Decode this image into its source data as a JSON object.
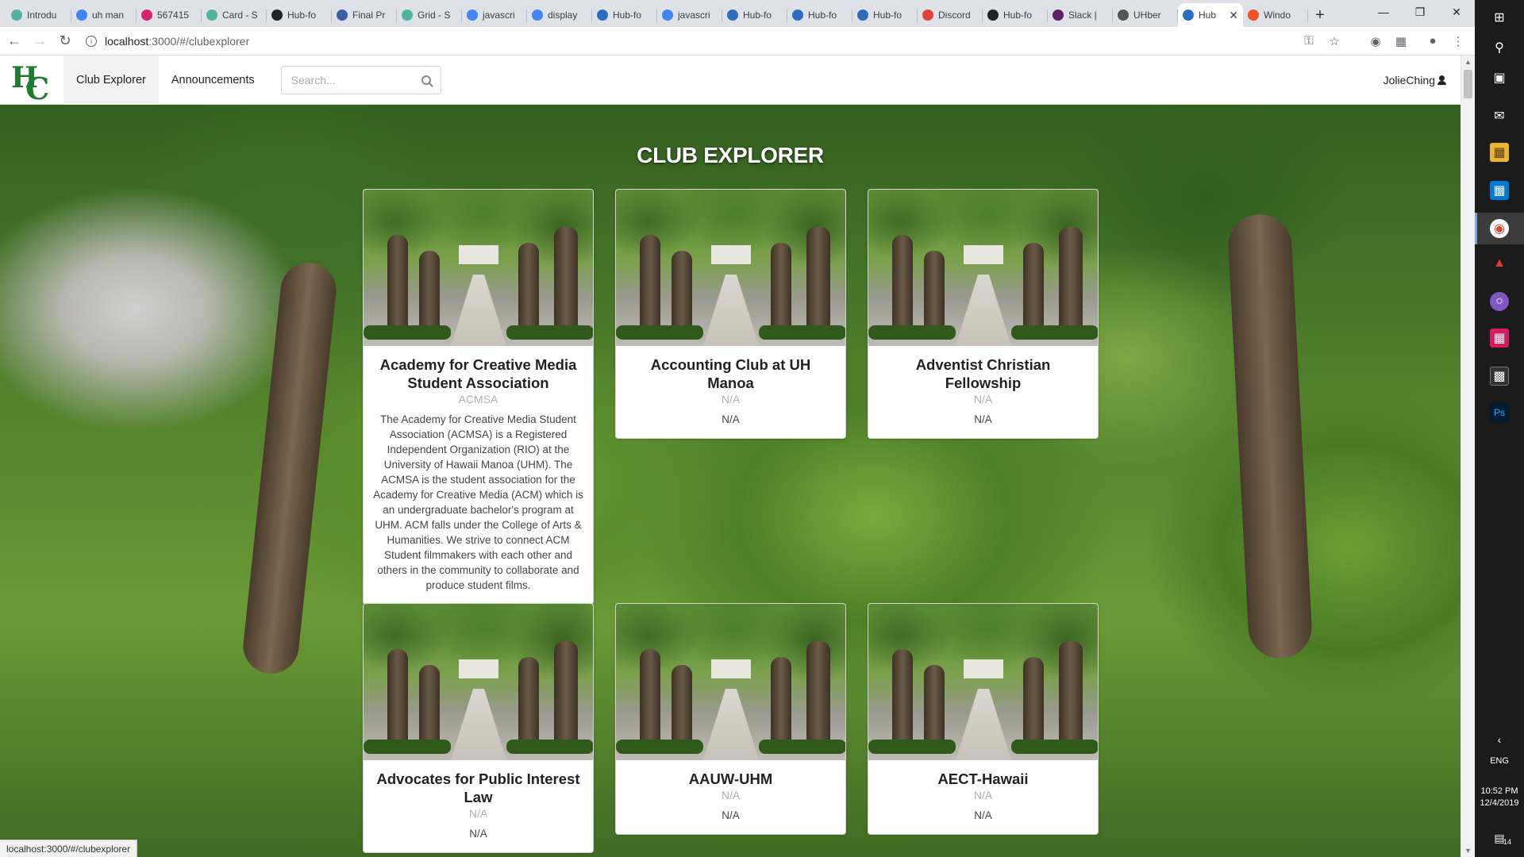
{
  "browser": {
    "tabs": [
      {
        "label": "Introdu",
        "color": "#4fb3a0"
      },
      {
        "label": "uh man",
        "color": "#4285f4"
      },
      {
        "label": "567415",
        "color": "#d6246e"
      },
      {
        "label": "Card - S",
        "color": "#4fb3a0"
      },
      {
        "label": "Hub-fo",
        "color": "#222222"
      },
      {
        "label": "Final Pr",
        "color": "#3b5ea7"
      },
      {
        "label": "Grid - S",
        "color": "#4fb3a0"
      },
      {
        "label": "javascri",
        "color": "#4285f4"
      },
      {
        "label": "display",
        "color": "#4285f4"
      },
      {
        "label": "Hub-fo",
        "color": "#2c6ebd"
      },
      {
        "label": "javascri",
        "color": "#4285f4"
      },
      {
        "label": "Hub-fo",
        "color": "#2c6ebd"
      },
      {
        "label": "Hub-fo",
        "color": "#2c6ebd"
      },
      {
        "label": "Hub-fo",
        "color": "#2c6ebd"
      },
      {
        "label": "Discord",
        "color": "#d9453b"
      },
      {
        "label": "Hub-fo",
        "color": "#222222"
      },
      {
        "label": "Slack |",
        "color": "#611f69"
      },
      {
        "label": "UHber",
        "color": "#555555"
      },
      {
        "label": "Hub",
        "color": "#2c6ebd"
      },
      {
        "label": "Windo",
        "color": "#f25022"
      }
    ],
    "active_tab_index": 18,
    "active_tab_close": "✕",
    "new_tab": "+",
    "window_controls": {
      "minimize": "—",
      "maximize": "❐",
      "close": "✕"
    },
    "url_host": "localhost",
    "url_path": ":3000/#/clubexplorer",
    "status_url": "localhost:3000/#/clubexplorer"
  },
  "navbar": {
    "logo_h": "H",
    "logo_c": "C",
    "items": [
      {
        "label": "Club Explorer",
        "active": true
      },
      {
        "label": "Announcements",
        "active": false
      }
    ],
    "search_placeholder": "Search...",
    "user": "JolieChing"
  },
  "page": {
    "title": "CLUB EXPLORER"
  },
  "cards": [
    {
      "title": "Academy for Creative Media Student Association",
      "meta": "ACMSA",
      "desc": "The Academy for Creative Media Student Association (ACMSA) is a Registered Independent Organization (RIO) at the University of Hawaii Manoa (UHM). The ACMSA is the student association for the Academy for Creative Media (ACM) which is an undergraduate bachelor's program at UHM. ACM falls under the College of Arts & Humanities. We strive to connect ACM Student filmmakers with each other and others in the community to collaborate and produce student films."
    },
    {
      "title": "Accounting Club at UH Manoa",
      "meta": "N/A",
      "desc": "N/A"
    },
    {
      "title": "Adventist Christian Fellowship",
      "meta": "N/A",
      "desc": "N/A"
    },
    {
      "title": "Advocates for Public Interest Law",
      "meta": "N/A",
      "desc": "N/A"
    },
    {
      "title": "AAUW-UHM",
      "meta": "N/A",
      "desc": "N/A"
    },
    {
      "title": "AECT-Hawaii",
      "meta": "N/A",
      "desc": "N/A"
    }
  ],
  "taskbar": {
    "lang": "ENG",
    "time": "10:52 PM",
    "date": "12/4/2019",
    "notif_count": "14"
  }
}
